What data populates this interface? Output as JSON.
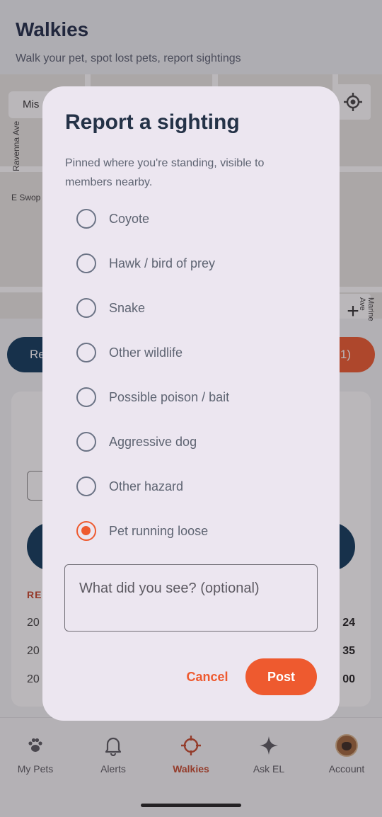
{
  "app": {
    "title": "Walkies",
    "subtitle": "Walk your pet, spot lost pets, report sightings"
  },
  "map": {
    "search_value": "Mis",
    "labels": [
      "Ravenna Ave",
      "E Swop",
      "Marine Ave"
    ],
    "zoom_in": "+"
  },
  "background": {
    "left_pill": "Re",
    "right_pill": "1)",
    "section_label": "REC",
    "rows": [
      {
        "left": "20",
        "right": "24"
      },
      {
        "left": "20",
        "right": "35"
      },
      {
        "left": "20",
        "right": "00"
      }
    ]
  },
  "tabs": [
    {
      "label": "My Pets",
      "icon": "paw-icon"
    },
    {
      "label": "Alerts",
      "icon": "bell-icon"
    },
    {
      "label": "Walkies",
      "icon": "crosshair-icon",
      "active": true
    },
    {
      "label": "Ask EL",
      "icon": "sparkle-icon"
    },
    {
      "label": "Account",
      "icon": "avatar"
    }
  ],
  "dialog": {
    "title": "Report a sighting",
    "description": "Pinned where you're standing, visible to members nearby.",
    "options": [
      {
        "label": "Coyote",
        "selected": false
      },
      {
        "label": "Hawk / bird of prey",
        "selected": false
      },
      {
        "label": "Snake",
        "selected": false
      },
      {
        "label": "Other wildlife",
        "selected": false
      },
      {
        "label": "Possible poison / bait",
        "selected": false
      },
      {
        "label": "Aggressive dog",
        "selected": false
      },
      {
        "label": "Other hazard",
        "selected": false
      },
      {
        "label": "Pet running loose",
        "selected": true
      }
    ],
    "notes_placeholder": "What did you see? (optional)",
    "notes_value": "",
    "cancel_label": "Cancel",
    "post_label": "Post"
  },
  "colors": {
    "accent": "#ee5a2f",
    "navy": "#0f3a5c",
    "dialog_bg": "#ece6f0",
    "title": "#243247"
  }
}
